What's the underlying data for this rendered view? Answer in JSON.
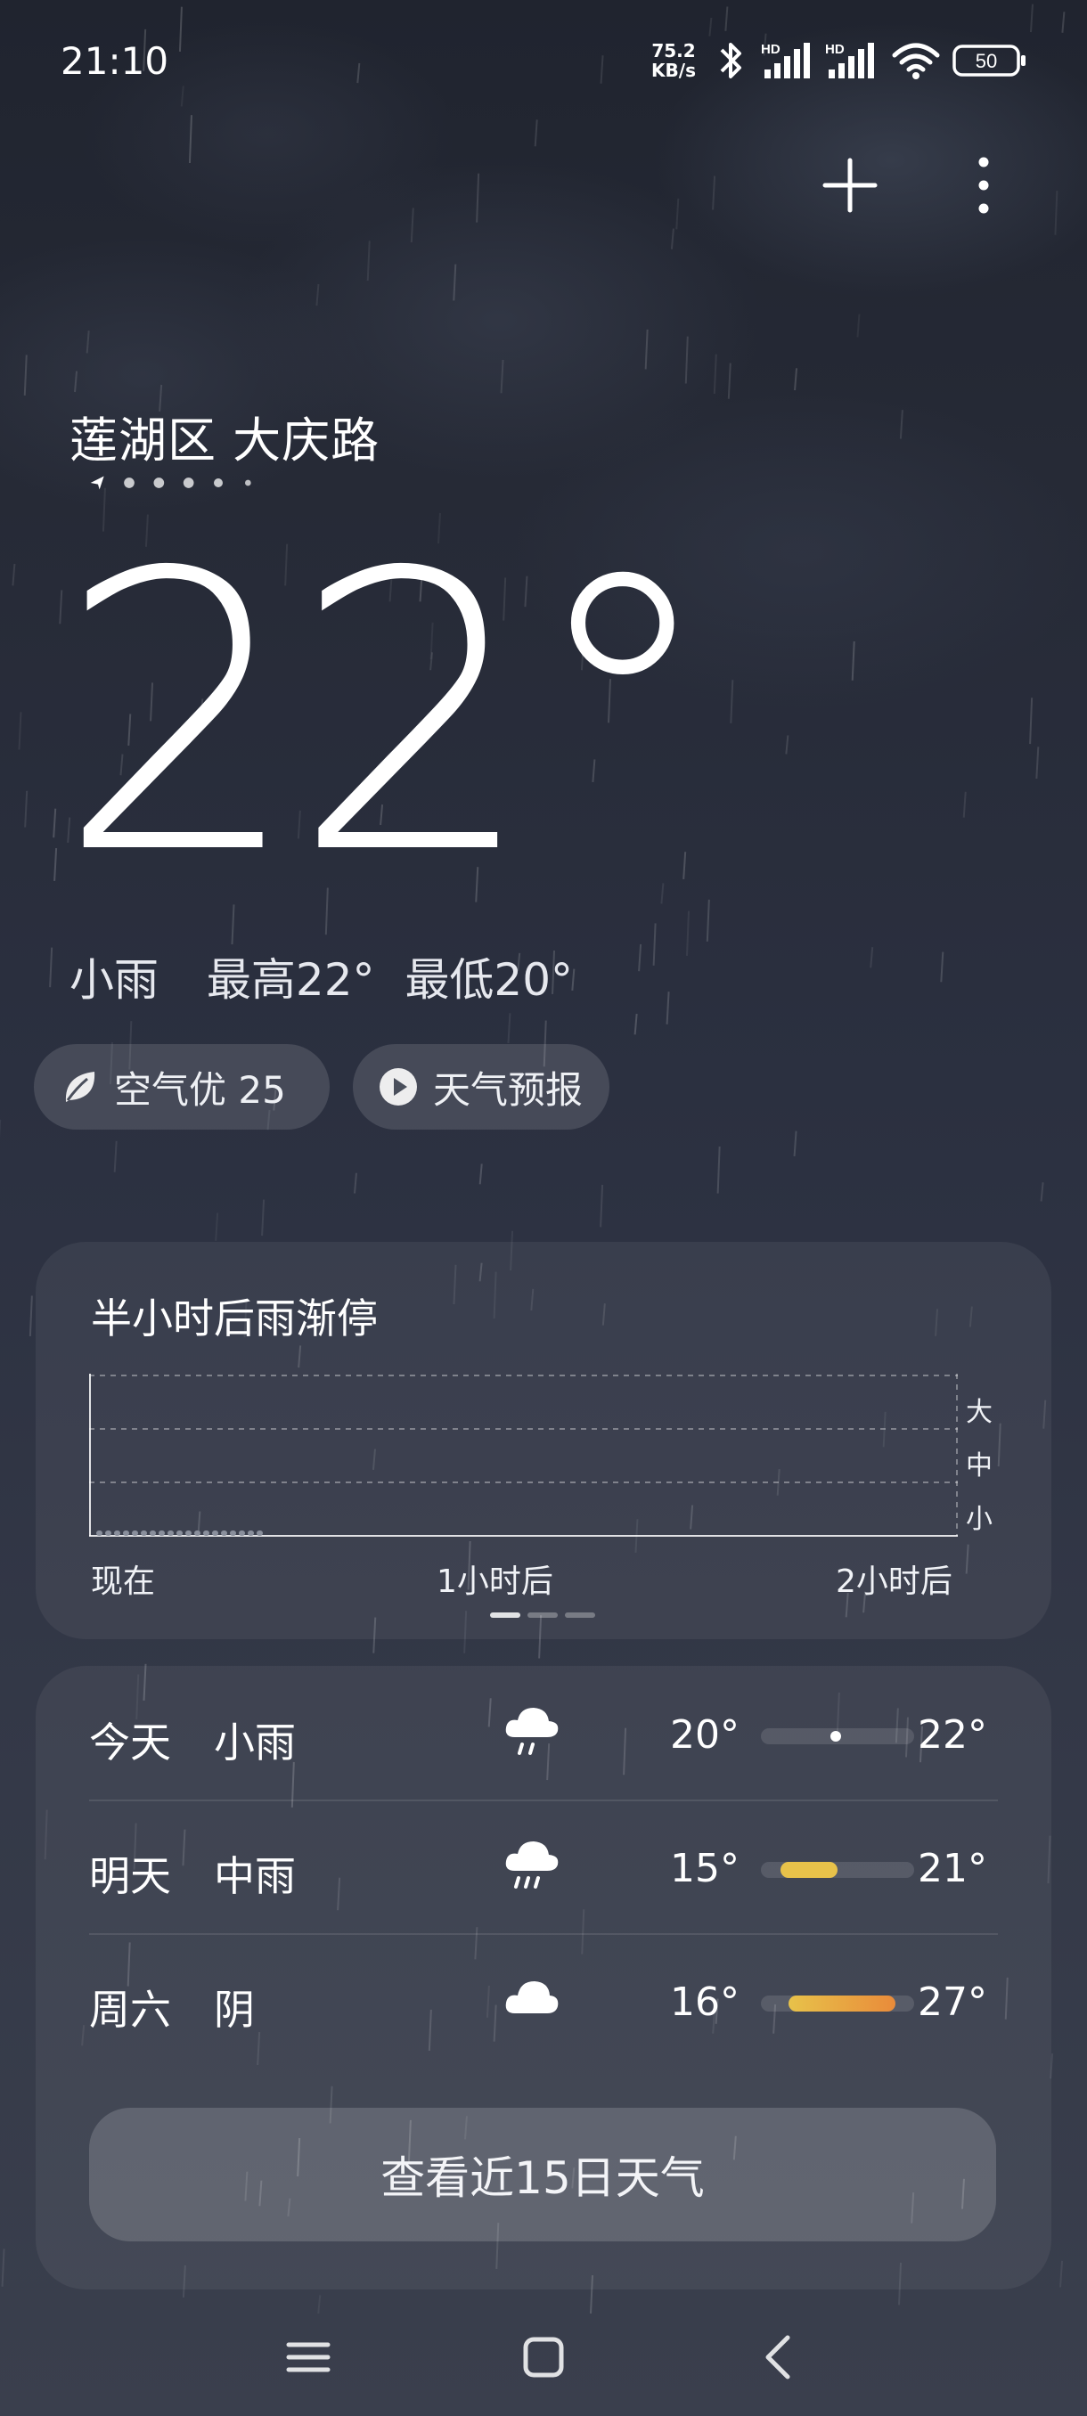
{
  "status_bar": {
    "time": "21:10",
    "net_speed_value": "75.2",
    "net_speed_unit": "KB/s",
    "signal1_label": "HD",
    "signal2_label": "HD",
    "battery": "50"
  },
  "location": {
    "name": "莲湖区 大庆路"
  },
  "current": {
    "temperature": "22°",
    "condition": "小雨",
    "high": "最高22°",
    "low": "最低20°"
  },
  "pills": {
    "air_quality": "空气优 25",
    "forecast_video": "天气预报"
  },
  "rain_card": {
    "title": "半小时后雨渐停",
    "x_labels": [
      "现在",
      "1小时后",
      "2小时后"
    ],
    "y_labels": [
      "大",
      "中",
      "小"
    ]
  },
  "forecast": {
    "rows": [
      {
        "day": "今天",
        "condition": "小雨",
        "icon": "light-rain-icon",
        "low": "20°",
        "high": "22°",
        "range_start": 0.0,
        "range_end": 0.0,
        "now_marker": 0.49,
        "fill_color": "#ffffff"
      },
      {
        "day": "明天",
        "condition": "中雨",
        "icon": "moderate-rain-icon",
        "low": "15°",
        "high": "21°",
        "range_start": 0.13,
        "range_end": 0.5,
        "fill_color": "#e8c24a"
      },
      {
        "day": "周六",
        "condition": "阴",
        "icon": "cloudy-icon",
        "low": "16°",
        "high": "27°",
        "range_start": 0.18,
        "range_end": 0.88,
        "fill_color": "#e98b3a"
      }
    ],
    "more_button": "查看近15日天气"
  },
  "colors": {
    "rain_bar": "#8a8f9c",
    "pill_bg": "rgba(255,255,255,0.13)"
  }
}
